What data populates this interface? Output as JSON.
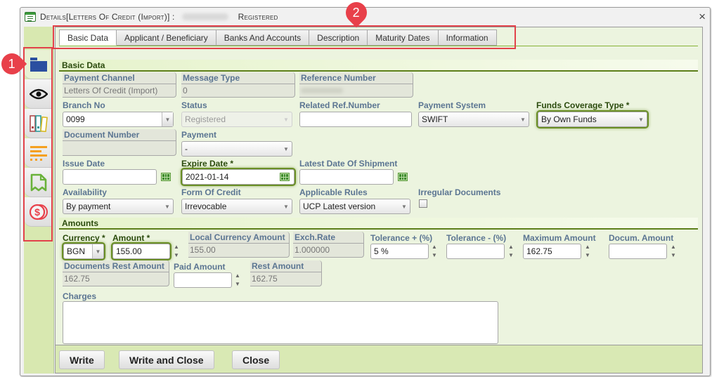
{
  "window": {
    "title_prefix": "Details[Letters Of Credit (Import)] :",
    "title_status": "Registered",
    "close_label": "×"
  },
  "annotations": {
    "marker1": "1",
    "marker2": "2"
  },
  "side_tabs": [
    {
      "name": "folder",
      "icon": "folder-icon",
      "color": "#2b4fa0",
      "active": true
    },
    {
      "name": "view",
      "icon": "eye-icon",
      "color": "#111111"
    },
    {
      "name": "binders",
      "icon": "binders-icon",
      "color": "#b04a4a"
    },
    {
      "name": "list",
      "icon": "list-lines-icon",
      "color": "#f5a020"
    },
    {
      "name": "document",
      "icon": "receipt-icon",
      "color": "#6ab23a"
    },
    {
      "name": "charges",
      "icon": "coins-dollar-icon",
      "color": "#e8404a"
    }
  ],
  "tabs": [
    {
      "label": "Basic Data",
      "active": true
    },
    {
      "label": "Applicant / Beneficiary"
    },
    {
      "label": "Banks And Accounts"
    },
    {
      "label": "Description"
    },
    {
      "label": "Maturity Dates"
    },
    {
      "label": "Information"
    }
  ],
  "sections": {
    "basic": "Basic Data",
    "amounts": "Amounts"
  },
  "basic": {
    "payment_channel": {
      "label": "Payment Channel",
      "value": "Letters Of Credit (Import)"
    },
    "message_type": {
      "label": "Message Type",
      "value": "0"
    },
    "reference_number": {
      "label": "Reference Number",
      "value": ""
    },
    "branch_no": {
      "label": "Branch No",
      "value": "0099"
    },
    "status": {
      "label": "Status",
      "value": "Registered"
    },
    "related_ref": {
      "label": "Related Ref.Number",
      "value": ""
    },
    "payment_system": {
      "label": "Payment System",
      "value": "SWIFT"
    },
    "funds_coverage": {
      "label": "Funds Coverage Type *",
      "value": "By Own Funds"
    },
    "document_number": {
      "label": "Document Number",
      "value": ""
    },
    "payment": {
      "label": "Payment",
      "value": "-"
    },
    "issue_date": {
      "label": "Issue Date",
      "value": ""
    },
    "expire_date": {
      "label": "Expire Date *",
      "value": "2021-01-14"
    },
    "latest_shipment": {
      "label": "Latest Date Of Shipment",
      "value": ""
    },
    "availability": {
      "label": "Availability",
      "value": "By payment"
    },
    "form_of_credit": {
      "label": "Form Of Credit",
      "value": "Irrevocable"
    },
    "applicable_rules": {
      "label": "Applicable Rules",
      "value": "UCP Latest version"
    },
    "irregular_docs": {
      "label": "Irregular Documents",
      "checked": false
    }
  },
  "amounts": {
    "currency": {
      "label": "Currency *",
      "value": "BGN"
    },
    "amount": {
      "label": "Amount *",
      "value": "155.00"
    },
    "local_amount": {
      "label": "Local Currency Amount",
      "value": "155.00"
    },
    "exch_rate": {
      "label": "Exch.Rate",
      "value": "1.000000"
    },
    "tol_plus": {
      "label": "Tolerance + (%)",
      "value": "5 %"
    },
    "tol_minus": {
      "label": "Tolerance - (%)",
      "value": ""
    },
    "max_amount": {
      "label": "Maximum Amount",
      "value": "162.75"
    },
    "docum_amount": {
      "label": "Docum. Amount",
      "value": ""
    },
    "docs_rest": {
      "label": "Documents Rest Amount",
      "value": "162.75"
    },
    "paid_amount": {
      "label": "Paid Amount",
      "value": ""
    },
    "rest_amount": {
      "label": "Rest Amount",
      "value": "162.75"
    },
    "charges": {
      "label": "Charges",
      "value": ""
    }
  },
  "footer": {
    "write": "Write",
    "write_close": "Write and Close",
    "close": "Close"
  }
}
